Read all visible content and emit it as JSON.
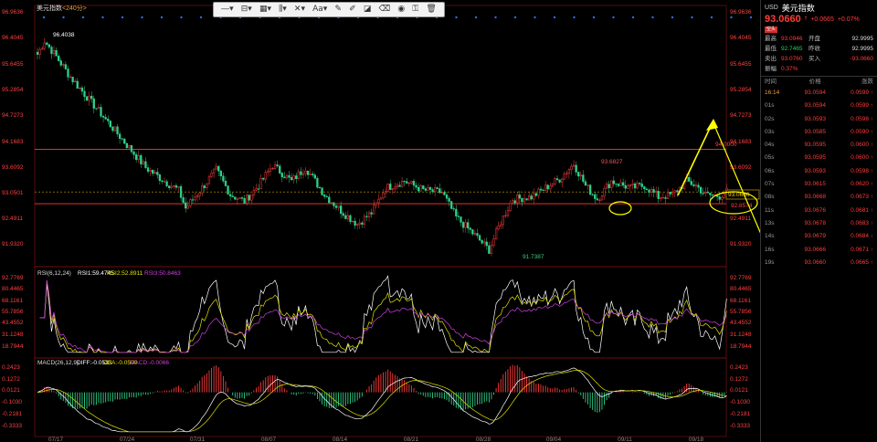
{
  "header": {
    "title": "美元指数",
    "period": "<240分>"
  },
  "toolbar": {
    "icons": [
      "horizontal-line-icon",
      "line-style-icon",
      "fibonacci-icon",
      "channel-icon",
      "grid-icon",
      "cross-icon",
      "text-icon",
      "pen-icon",
      "brush-icon",
      "eraser-icon",
      "paint-icon",
      "eye-icon",
      "lock-icon",
      "trash-icon"
    ],
    "labels": [
      "—▾",
      "⊞▾",
      "▤▾",
      "Aa▾"
    ]
  },
  "top_right_label": "全部主题",
  "colors": {
    "up": "#ff3b3b",
    "down": "#2ed18a",
    "resistance": "#ff3838",
    "annotation": "#ffff00",
    "rsi1": "#ffffff",
    "rsi2": "#e0e000",
    "rsi3": "#d040e0",
    "diff": "#ffffff",
    "dea": "#e0e000"
  },
  "chart_data": [
    {
      "type": "candlestick",
      "title": "美元指数",
      "ylim": [
        91.55,
        97.1
      ],
      "yticks": [
        "96.9636",
        "96.4045",
        "95.6455",
        "95.2854",
        "94.7273",
        "94.1683",
        "93.6092",
        "93.0501",
        "92.4911",
        "91.9320"
      ],
      "xticks": [
        "07/17",
        "07/24",
        "07/31",
        "08/07",
        "08/14",
        "08/21",
        "08/28",
        "09/04",
        "09/11",
        "09/18"
      ],
      "annotations": {
        "high": "96.4038",
        "low": "91.7387",
        "peak": "93.6827",
        "line1_label": "94.0000",
        "price_box": "93.0660",
        "lower_tag": "92.8574"
      },
      "horizontal_lines": [
        94.0,
        93.06,
        92.8
      ],
      "anchors": [
        [
          0,
          96.1
        ],
        [
          3,
          96.4
        ],
        [
          8,
          96.05
        ],
        [
          14,
          95.6
        ],
        [
          22,
          95.1
        ],
        [
          30,
          94.6
        ],
        [
          38,
          94.1
        ],
        [
          46,
          93.6
        ],
        [
          54,
          93.3
        ],
        [
          60,
          93.1
        ],
        [
          63,
          92.7
        ],
        [
          70,
          93.15
        ],
        [
          76,
          93.55
        ],
        [
          82,
          93.0
        ],
        [
          88,
          92.85
        ],
        [
          94,
          93.2
        ],
        [
          100,
          93.65
        ],
        [
          108,
          93.3
        ],
        [
          114,
          93.6
        ],
        [
          122,
          93.0
        ],
        [
          130,
          92.6
        ],
        [
          136,
          92.35
        ],
        [
          142,
          92.6
        ],
        [
          148,
          93.15
        ],
        [
          156,
          93.3
        ],
        [
          164,
          93.1
        ],
        [
          172,
          93.05
        ],
        [
          178,
          92.5
        ],
        [
          186,
          92.1
        ],
        [
          192,
          91.78
        ],
        [
          197,
          92.4
        ],
        [
          202,
          92.9
        ],
        [
          210,
          92.95
        ],
        [
          216,
          93.15
        ],
        [
          222,
          93.35
        ],
        [
          228,
          93.68
        ],
        [
          233,
          93.2
        ],
        [
          238,
          92.9
        ],
        [
          244,
          93.3
        ],
        [
          252,
          93.15
        ],
        [
          258,
          93.2
        ],
        [
          264,
          92.95
        ],
        [
          270,
          93.0
        ],
        [
          276,
          93.3
        ],
        [
          280,
          93.2
        ],
        [
          284,
          93.0
        ],
        [
          290,
          92.97
        ],
        [
          293,
          93.07
        ]
      ]
    },
    {
      "type": "line",
      "title": "RSI(6,12,24)",
      "legend": [
        "RSI1:59.4745",
        "RSI2:52.8911",
        "RSI3:50.8463"
      ],
      "yticks": [
        "92.7769",
        "80.4465",
        "68.1161",
        "55.7856",
        "43.4552",
        "31.1248",
        "18.7944"
      ],
      "ylim": [
        14,
        97
      ]
    },
    {
      "type": "bar",
      "title": "MACD(26,12,9)",
      "legend": [
        "DIFF:-0.0533",
        "DEA:-0.0500",
        "MACD:-0.0066"
      ],
      "yticks": [
        "0.2423",
        "0.1272",
        "0.0121",
        "-0.1030",
        "-0.2181",
        "-0.3333"
      ],
      "ylim": [
        -0.37,
        0.28
      ]
    }
  ],
  "sidebar": {
    "symbol": "USD",
    "name": "美元指数",
    "price": "93.0660",
    "change": "+0.0665",
    "change_pct": "+0.07%",
    "tag": "空头",
    "quote": [
      [
        "最高",
        "93.0946",
        "开盘",
        "92.9995"
      ],
      [
        "最低",
        "92.7465",
        "昨收",
        "92.9995"
      ],
      [
        "卖出",
        "93.0760",
        "买入",
        "-93.0660"
      ],
      [
        "振幅",
        "0.37%",
        "",
        ""
      ]
    ],
    "tick_header": [
      "时间",
      "价格",
      "涨跌"
    ],
    "ticks": [
      [
        "16:14",
        "93.0594",
        "0.0599"
      ],
      [
        "01s",
        "93.0594",
        "0.0599"
      ],
      [
        "02s",
        "93.0593",
        "0.0598"
      ],
      [
        "03s",
        "93.0585",
        "0.0590"
      ],
      [
        "04s",
        "93.0595",
        "0.0600"
      ],
      [
        "05s",
        "93.0595",
        "0.0600"
      ],
      [
        "06s",
        "93.0593",
        "0.0598"
      ],
      [
        "07s",
        "93.0615",
        "0.0620"
      ],
      [
        "08s",
        "93.0668",
        "0.0673"
      ],
      [
        "11s",
        "93.0676",
        "0.0681"
      ],
      [
        "13s",
        "93.0678",
        "0.0683"
      ],
      [
        "14s",
        "93.0679",
        "0.0684"
      ],
      [
        "16s",
        "93.0666",
        "0.0671"
      ],
      [
        "19s",
        "93.0660",
        "0.0665"
      ]
    ]
  }
}
